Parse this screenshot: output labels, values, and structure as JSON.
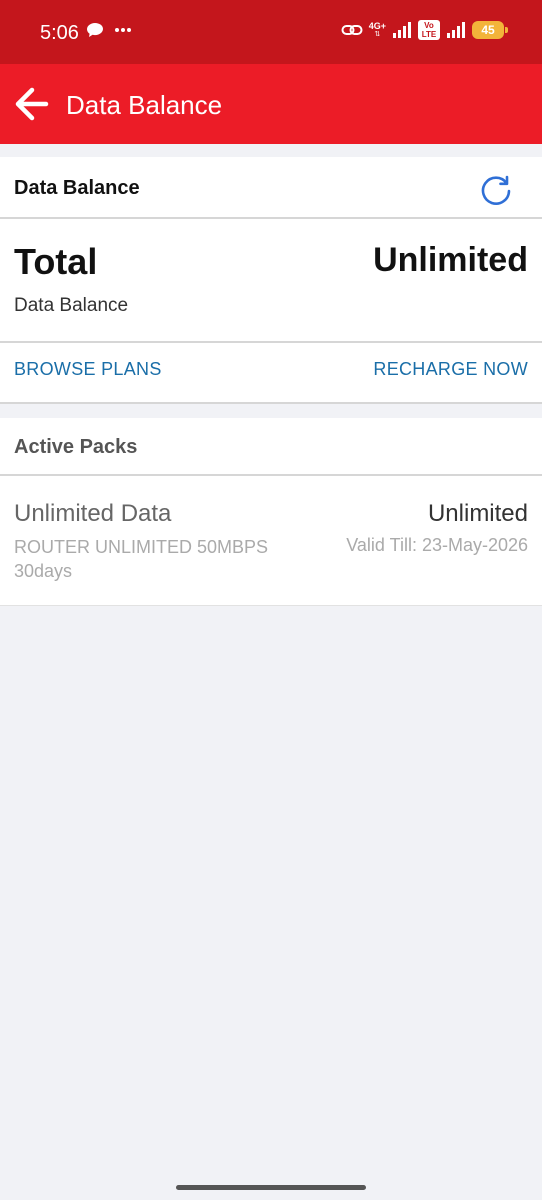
{
  "status_bar": {
    "time": "5:06",
    "network": "4G+",
    "volte": "Vo LTE",
    "battery": "45"
  },
  "app_bar": {
    "title": "Data Balance"
  },
  "balance_card": {
    "header": "Data Balance",
    "total_label": "Total",
    "total_value": "Unlimited",
    "total_sub": "Data Balance",
    "browse_plans": "BROWSE PLANS",
    "recharge_now": "RECHARGE NOW"
  },
  "active_packs": {
    "header": "Active Packs",
    "packs": [
      {
        "name": "Unlimited Data",
        "value": "Unlimited",
        "description": "ROUTER UNLIMITED 50MBPS 30days",
        "valid_till": "Valid Till: 23-May-2026"
      }
    ]
  },
  "colors": {
    "status_bar": "#c4161c",
    "app_bar": "#ec1c27",
    "link": "#1a6ea8",
    "refresh_icon": "#2f6fd6",
    "background": "#f1f2f6"
  },
  "icons": {
    "back": "arrow-left-icon",
    "refresh": "refresh-icon"
  }
}
